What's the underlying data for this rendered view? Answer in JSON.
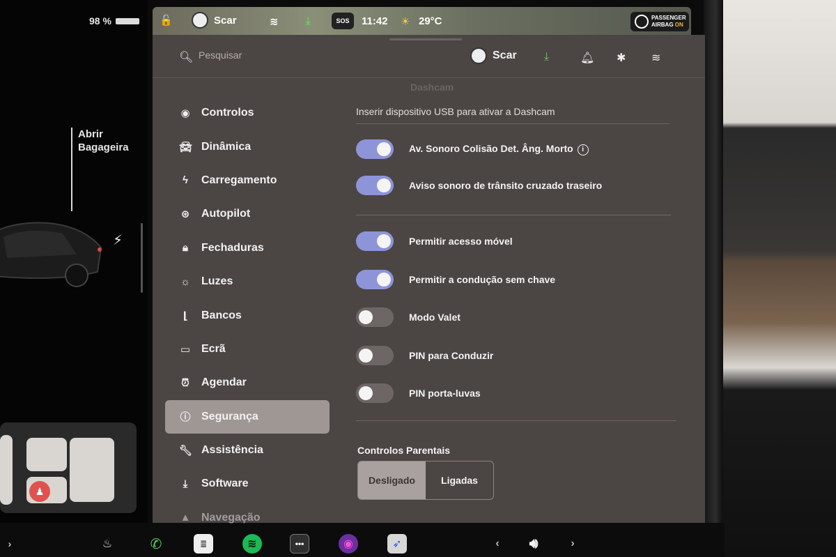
{
  "status": {
    "battery": "98 %",
    "user": "Scar",
    "sos": "SOS",
    "time": "11:42",
    "temperature": "29°C",
    "airbag_line1": "PASSENGER",
    "airbag_line2": "AIRBAG",
    "airbag_state": "ON"
  },
  "car": {
    "trunk_label_1": "Abrir",
    "trunk_label_2": "Bagageira"
  },
  "topbar": {
    "search_placeholder": "Pesquisar",
    "user": "Scar"
  },
  "sidebar": {
    "items": [
      {
        "label": "Controlos",
        "icon": "toggle-icon"
      },
      {
        "label": "Dinâmica",
        "icon": "car-icon"
      },
      {
        "label": "Carregamento",
        "icon": "bolt-icon"
      },
      {
        "label": "Autopilot",
        "icon": "steering-wheel-icon"
      },
      {
        "label": "Fechaduras",
        "icon": "lock-icon"
      },
      {
        "label": "Luzes",
        "icon": "sun-icon"
      },
      {
        "label": "Bancos",
        "icon": "seat-icon"
      },
      {
        "label": "Ecrã",
        "icon": "display-icon"
      },
      {
        "label": "Agendar",
        "icon": "alarm-clock-icon"
      },
      {
        "label": "Segurança",
        "icon": "alert-circle-icon",
        "active": true
      },
      {
        "label": "Assistência",
        "icon": "wrench-icon"
      },
      {
        "label": "Software",
        "icon": "download-icon"
      },
      {
        "label": "Navegação",
        "icon": "navigation-icon"
      }
    ]
  },
  "content": {
    "dashcam_header": "Dashcam",
    "usb_message": "Inserir dispositivo USB para ativar a Dashcam",
    "toggles": [
      {
        "label": "Av. Sonoro Colisão Det. Âng. Morto",
        "on": true,
        "info": true
      },
      {
        "label": "Aviso sonoro de trânsito cruzado traseiro",
        "on": true
      },
      {
        "label": "Permitir acesso móvel",
        "on": true
      },
      {
        "label": "Permitir a condução sem chave",
        "on": true
      },
      {
        "label": "Modo Valet",
        "on": false
      },
      {
        "label": "PIN para Conduzir",
        "on": false
      },
      {
        "label": "PIN porta-luvas",
        "on": false
      }
    ],
    "parental_title": "Controlos Parentais",
    "parental_options": [
      "Desligado",
      "Ligadas"
    ],
    "parental_selected": "Desligado"
  },
  "colors": {
    "toggle_on": "#8d94d8",
    "toggle_off": "#6d6664",
    "panel_bg": "#4b4544",
    "active_nav": "#9e9794",
    "download_green": "#5fd35a"
  }
}
